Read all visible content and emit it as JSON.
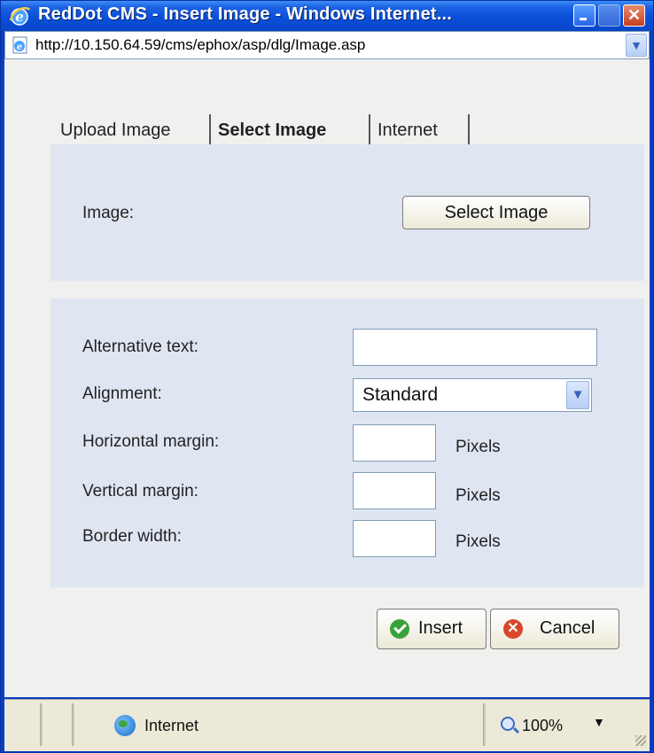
{
  "window": {
    "title": "RedDot CMS - Insert Image - Windows Internet...",
    "address": "http://10.150.64.59/cms/ephox/asp/dlg/Image.asp"
  },
  "tabs": [
    {
      "label": "Upload Image",
      "active": false
    },
    {
      "label": "Select Image",
      "active": true
    },
    {
      "label": "Internet",
      "active": false
    }
  ],
  "image_section": {
    "label": "Image:",
    "button_label": "Select Image"
  },
  "properties": {
    "alt_text": {
      "label": "Alternative text:",
      "value": ""
    },
    "alignment": {
      "label": "Alignment:",
      "value": "Standard"
    },
    "horizontal_margin": {
      "label": "Horizontal margin:",
      "value": "",
      "unit": "Pixels"
    },
    "vertical_margin": {
      "label": "Vertical margin:",
      "value": "",
      "unit": "Pixels"
    },
    "border_width": {
      "label": "Border width:",
      "value": "",
      "unit": "Pixels"
    }
  },
  "actions": {
    "insert_label": "Insert",
    "cancel_label": "Cancel"
  },
  "statusbar": {
    "zone": "Internet",
    "zoom": "100%"
  },
  "icons": [
    "ie-logo-icon",
    "minimize-icon",
    "maximize-icon",
    "close-icon",
    "page-icon",
    "dropdown-arrow-icon",
    "check-icon",
    "cancel-icon",
    "globe-icon",
    "zoom-icon",
    "resize-grip-icon"
  ],
  "colors": {
    "titlebar": "#0a4fd9",
    "panel": "#dfe6f2",
    "client": "#f0f0ee",
    "statusbar": "#ece9d8"
  }
}
